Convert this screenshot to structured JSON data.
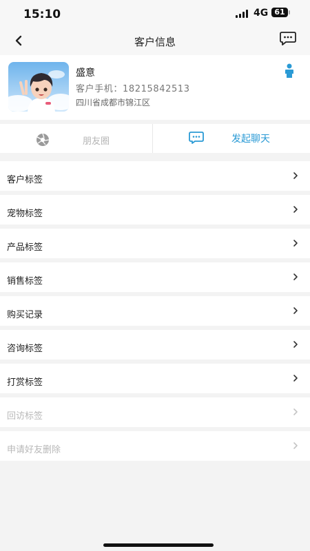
{
  "status_bar": {
    "time": "15:10",
    "network": "4G",
    "battery": "61"
  },
  "nav": {
    "title": "客户信息",
    "back_icon": "chevron-left-icon",
    "chat_icon": "message-bubble-icon"
  },
  "profile": {
    "name": "盛意",
    "phone": "客户手机：18215842513",
    "address": "四川省成都市锦江区",
    "gender_icon": "person-icon",
    "accent": "#2a9ad5"
  },
  "actions": {
    "moments_label": "朋友圈",
    "moments_icon": "camera-shutter-icon",
    "start_chat_label": "发起聊天",
    "start_chat_icon": "chat-bubble-icon"
  },
  "menu": {
    "items": [
      {
        "label": "客户标签",
        "enabled": true
      },
      {
        "label": "宠物标签",
        "enabled": true
      },
      {
        "label": "产品标签",
        "enabled": true
      },
      {
        "label": "销售标签",
        "enabled": true
      },
      {
        "label": "购买记录",
        "enabled": true
      },
      {
        "label": "咨询标签",
        "enabled": true
      },
      {
        "label": "打赏标签",
        "enabled": true
      },
      {
        "label": "回访标签",
        "enabled": false
      },
      {
        "label": "申请好友删除",
        "enabled": false
      }
    ]
  }
}
